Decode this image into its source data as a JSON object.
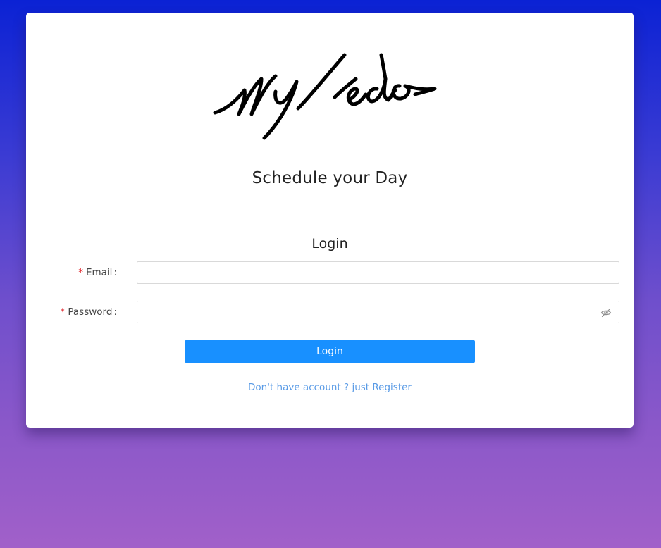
{
  "logo": {
    "text": "My todo",
    "icon": "handwritten-signature-logo"
  },
  "tagline": "Schedule your Day",
  "form": {
    "title": "Login",
    "email": {
      "label": "Email",
      "required_mark": "*",
      "value": "",
      "placeholder": ""
    },
    "password": {
      "label": "Password",
      "required_mark": "*",
      "value": "",
      "placeholder": "",
      "toggle_icon": "eye-invisible-icon"
    },
    "submit_label": "Login",
    "register_link": "Don't have account ? just Register"
  },
  "colors": {
    "primary": "#1890ff",
    "link": "#5a9be6",
    "required": "#e0262c",
    "card": "#ffffff"
  }
}
